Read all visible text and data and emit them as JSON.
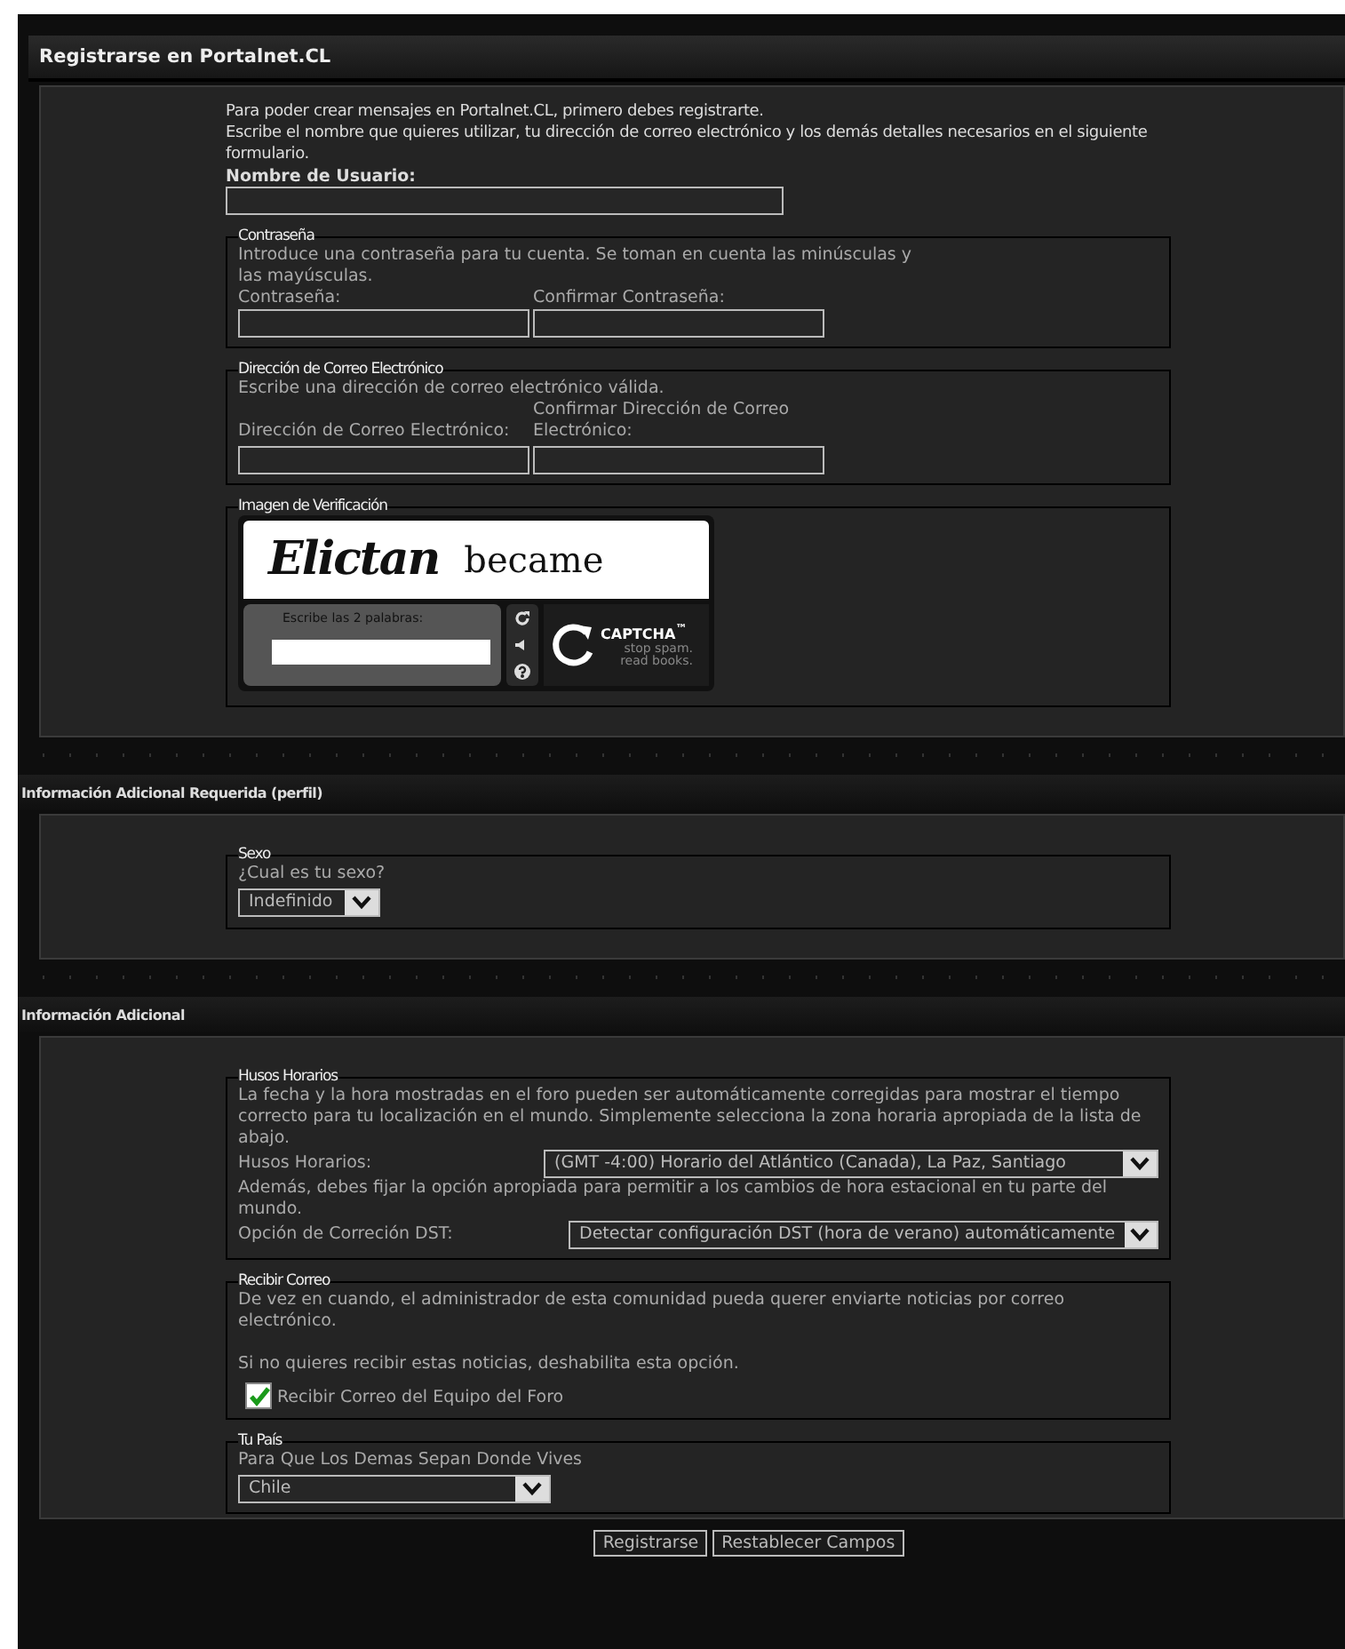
{
  "title": "Registrarse en Portalnet.CL",
  "intro": [
    "Para poder crear mensajes en Portalnet.CL, primero debes registrarte.",
    "Escribe el nombre que quieres utilizar, tu dirección de correo electrónico y los demás detalles necesarios en el siguiente formulario."
  ],
  "username": {
    "label": "Nombre de Usuario:"
  },
  "password": {
    "legend": "Contraseña",
    "hint": "Introduce una contraseña para tu cuenta. Se toman en cuenta las minúsculas y las mayúsculas.",
    "fields": [
      "Contraseña:",
      "Confirmar Contraseña:"
    ]
  },
  "email": {
    "legend": "Dirección de Correo Electrónico",
    "hint": "Escribe una dirección de correo electrónico válida.",
    "fields": [
      "Dirección de Correo Electrónico:",
      "Confirmar Dirección de Correo Electrónico:"
    ]
  },
  "captcha": {
    "legend": "Imagen de Verificación",
    "words": [
      "Elictan",
      "became"
    ],
    "prompt": "Escribe las 2 palabras:",
    "brand": "CAPTCHA",
    "trademark": "™",
    "slogan": "stop spam. read books."
  },
  "profile": {
    "title": "Información Adicional Requerida (perfil)",
    "legend": "Sexo",
    "question": "¿Cual es tu sexo?",
    "value": "Indefinido"
  },
  "additional": {
    "title": "Información Adicional",
    "timezone": {
      "legend": "Husos Horarios",
      "hint": "La fecha y la hora mostradas en el foro pueden ser automáticamente corregidas para mostrar el tiempo correcto para tu localización en el mundo. Simplemente selecciona la zona horaria apropiada de la lista de abajo.",
      "label": "Husos Horarios:",
      "value": "(GMT -4:00) Horario del Atlántico (Canada), La Paz, Santiago",
      "dst_hint": "Además, debes fijar la opción apropiada para permitir a los cambios de hora estacional en tu parte del mundo.",
      "dst_label": "Opción de Correción DST:",
      "dst_value": "Detectar configuración DST (hora de verano) automáticamente"
    },
    "mail": {
      "legend": "Recibir Correo",
      "hint": "De vez en cuando, el administrador de esta comunidad pueda querer enviarte noticias por correo electrónico.",
      "hint2": "Si no quieres recibir estas noticias, deshabilita esta opción.",
      "checkbox": {
        "label": "Recibir Correo del Equipo del Foro",
        "checked": true
      }
    },
    "country": {
      "legend": "Tu País",
      "hint": "Para Que Los Demas Sepan Donde Vives",
      "value": "Chile"
    }
  },
  "buttons": [
    "Registrarse",
    "Restablecer Campos"
  ]
}
